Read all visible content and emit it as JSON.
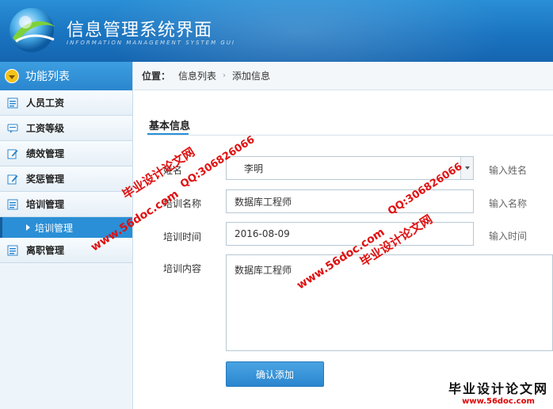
{
  "app": {
    "title": "信息管理系统界面",
    "subtitle": "INFORMATION MANAGEMENT SYSTEM GUI"
  },
  "sidebar": {
    "header": "功能列表",
    "items": [
      {
        "label": "人员工资",
        "icon": "list-icon"
      },
      {
        "label": "工资等级",
        "icon": "chat-icon"
      },
      {
        "label": "绩效管理",
        "icon": "edit-icon"
      },
      {
        "label": "奖惩管理",
        "icon": "edit-icon"
      },
      {
        "label": "培训管理",
        "icon": "list-icon"
      },
      {
        "label": "离职管理",
        "icon": "list-icon"
      }
    ],
    "active_sub": "培训管理"
  },
  "breadcrumb": {
    "lead": "位置：",
    "items": [
      "信息列表",
      "添加信息"
    ]
  },
  "form": {
    "section_title": "基本信息",
    "name": {
      "label": "姓名",
      "value": "李明",
      "hint": "输入姓名"
    },
    "training_name": {
      "label": "培训名称",
      "value": "数据库工程师",
      "hint": "输入名称"
    },
    "training_time": {
      "label": "培训时间",
      "value": "2016-08-09",
      "hint": "输入时间"
    },
    "training_content": {
      "label": "培训内容",
      "value": "数据库工程师"
    },
    "submit_label": "确认添加"
  },
  "watermark": {
    "site": "www.56doc.com",
    "qq": "QQ:306826066",
    "brand": "毕业设计论文网",
    "footer_site": "www.56doc.com"
  }
}
